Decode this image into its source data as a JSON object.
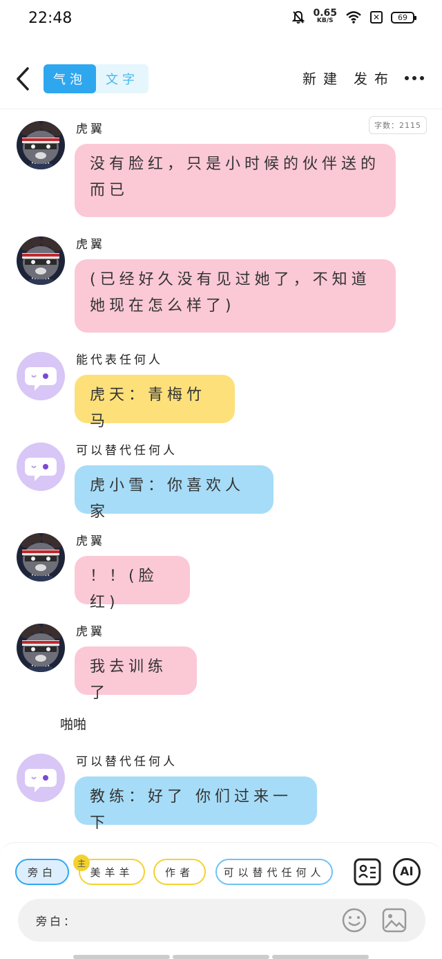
{
  "status_bar": {
    "time": "22:48",
    "net_speed_value": "0.65",
    "net_speed_unit": "KB/S",
    "battery": "69",
    "icons": [
      "bell-muted-icon",
      "wifi-icon",
      "x-box-icon",
      "battery-icon"
    ]
  },
  "header": {
    "tabs": [
      {
        "label": "气泡",
        "active": true
      },
      {
        "label": "文字",
        "active": false
      }
    ],
    "new_label": "新建",
    "publish_label": "发布"
  },
  "word_count": "字数：2115",
  "colors": {
    "accent": "#2ea7ef",
    "bubble_pink": "#fbc8d6",
    "bubble_yellow": "#fde07a",
    "bubble_blue": "#a6dcf7",
    "avatar_purple": "#d8c6f6"
  },
  "messages": [
    {
      "speaker": "虎翼",
      "text": "没有脸红，只是小时候的伙伴送的而已",
      "bubble": "pink",
      "avatar": "tiger-avatar"
    },
    {
      "speaker": "虎翼",
      "text": "(已经好久没有见过她了，不知道她现在怎么样了)",
      "bubble": "pink",
      "avatar": "tiger-avatar"
    },
    {
      "speaker": "能代表任何人",
      "text": "虎天：青梅竹马",
      "bubble": "yellow",
      "avatar": "chat-bubble-avatar"
    },
    {
      "speaker": "可以替代任何人",
      "text": "虎小雪：你喜欢人家",
      "bubble": "blue",
      "avatar": "chat-bubble-avatar"
    },
    {
      "speaker": "虎翼",
      "text": "！！(脸红)",
      "bubble": "pink",
      "avatar": "tiger-avatar"
    },
    {
      "speaker": "虎翼",
      "text": "我去训练了",
      "bubble": "pink",
      "avatar": "tiger-avatar"
    },
    {
      "speaker": "可以替代任何人",
      "text": "教练：好了 你们过来一下",
      "bubble": "blue",
      "avatar": "chat-bubble-avatar"
    }
  ],
  "narration": "啪啪",
  "roles": [
    {
      "label": "旁白",
      "active": true
    },
    {
      "label": "美羊羊",
      "host": true,
      "host_badge": "主"
    },
    {
      "label": "作者"
    },
    {
      "label": "可以替代任何人"
    }
  ],
  "tools": {
    "character_card_icon": "id-card-icon",
    "ai_label": "AI"
  },
  "input": {
    "label": "旁白：",
    "value": ""
  }
}
